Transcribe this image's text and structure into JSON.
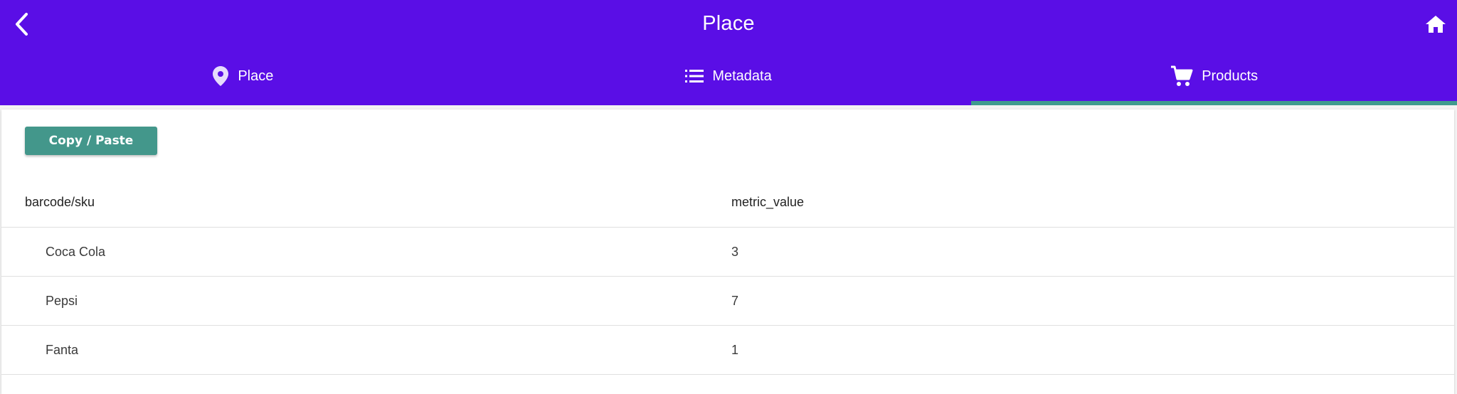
{
  "app": {
    "title": "Place"
  },
  "tabs": [
    {
      "label": "Place",
      "icon": "map-pin-icon"
    },
    {
      "label": "Metadata",
      "icon": "list-icon"
    },
    {
      "label": "Products",
      "icon": "cart-icon",
      "active": true
    }
  ],
  "colors": {
    "appbar": "#5a0ee6",
    "accent": "#3f9b8e",
    "button": "#43978b"
  },
  "actions": {
    "copy_paste_label": "Copy / Paste"
  },
  "table": {
    "columns": [
      "barcode/sku",
      "metric_value"
    ],
    "rows": [
      [
        "Coca Cola",
        "3"
      ],
      [
        "Pepsi",
        "7"
      ],
      [
        "Fanta",
        "1"
      ]
    ]
  }
}
